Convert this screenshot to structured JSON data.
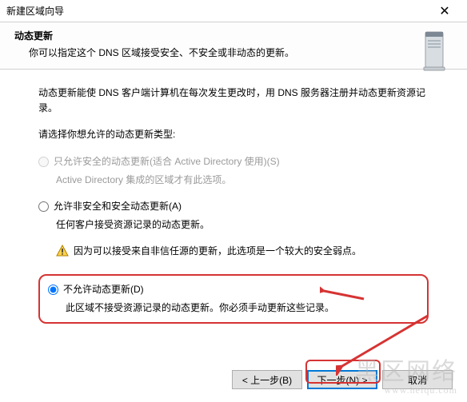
{
  "window": {
    "title": "新建区域向导",
    "close": "✕"
  },
  "header": {
    "title": "动态更新",
    "subtitle": "你可以指定这个 DNS 区域接受安全、不安全或非动态的更新。"
  },
  "content": {
    "desc": "动态更新能使 DNS 客户端计算机在每次发生更改时，用 DNS 服务器注册并动态更新资源记录。",
    "prompt": "请选择你想允许的动态更新类型:",
    "opt1": {
      "label": "只允许安全的动态更新(适合 Active Directory 使用)(S)",
      "desc": "Active Directory 集成的区域才有此选项。"
    },
    "opt2": {
      "label": "允许非安全和安全动态更新(A)",
      "desc1": "任何客户接受资源记录的动态更新。",
      "desc2": "因为可以接受来自非信任源的更新，此选项是一个较大的安全弱点。"
    },
    "opt3": {
      "label": "不允许动态更新(D)",
      "desc": "此区域不接受资源记录的动态更新。你必须手动更新这些记录。"
    }
  },
  "buttons": {
    "back": "< 上一步(B)",
    "next": "下一步(N) >",
    "cancel": "取消"
  },
  "watermark": {
    "line1": "黑区网络",
    "line2": "www.heiqu.com"
  }
}
